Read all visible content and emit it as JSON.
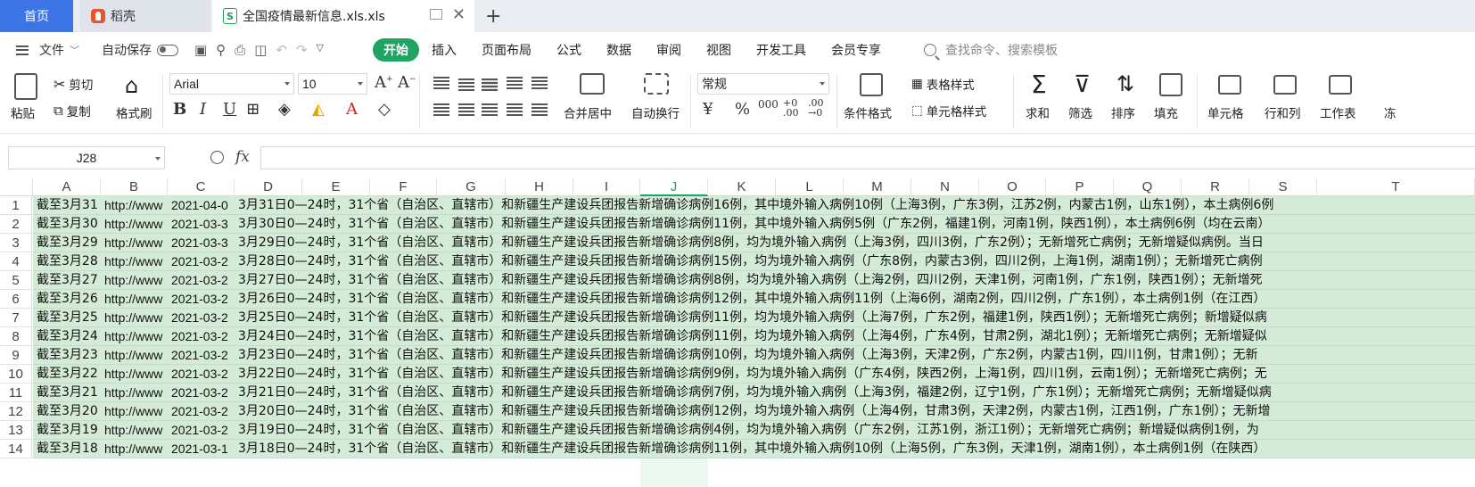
{
  "tabs": {
    "home": "首页",
    "daoke": "稻壳",
    "file": "全国疫情最新信息.xls.xls"
  },
  "menu": {
    "file_label": "文件",
    "autosave_label": "自动保存",
    "ribbon_tabs": [
      "开始",
      "插入",
      "页面布局",
      "公式",
      "数据",
      "审阅",
      "视图",
      "开发工具",
      "会员专享"
    ],
    "search_placeholder": "查找命令、搜索模板"
  },
  "ribbon": {
    "paste": "粘贴",
    "cut": "剪切",
    "copy": "复制",
    "format_painter": "格式刷",
    "font_name": "Arial",
    "font_size": "10",
    "merge_center": "合并居中",
    "wrap_text": "自动换行",
    "number_format": "常规",
    "conditional_format": "条件格式",
    "table_style": "表格样式",
    "cell_style": "单元格样式",
    "sum": "求和",
    "filter": "筛选",
    "sort": "排序",
    "fill": "填充",
    "cell": "单元格",
    "row_col": "行和列",
    "worksheet": "工作表",
    "freeze": "冻"
  },
  "formula_bar": {
    "cell_ref": "J28",
    "fx": "fx",
    "formula": ""
  },
  "columns": [
    "A",
    "B",
    "C",
    "D",
    "E",
    "F",
    "G",
    "H",
    "I",
    "J",
    "K",
    "L",
    "M",
    "N",
    "O",
    "P",
    "Q",
    "R",
    "S",
    "T"
  ],
  "selected_column": "J",
  "rows": [
    {
      "n": "1",
      "a": "截至3月31",
      "b": "http://www",
      "c": "2021-04-0",
      "d": "3月31日0—24时，31个省（自治区、直辖市）和新疆生产建设兵团报告新增确诊病例16例，其中境外输入病例10例（上海3例，广东3例，江苏2例，内蒙古1例，山东1例），本土病例6例"
    },
    {
      "n": "2",
      "a": "截至3月30",
      "b": "http://www",
      "c": "2021-03-3",
      "d": "3月30日0—24时，31个省（自治区、直辖市）和新疆生产建设兵团报告新增确诊病例11例，其中境外输入病例5例（广东2例，福建1例，河南1例，陕西1例），本土病例6例（均在云南）"
    },
    {
      "n": "3",
      "a": "截至3月29",
      "b": "http://www",
      "c": "2021-03-3",
      "d": "3月29日0—24时，31个省（自治区、直辖市）和新疆生产建设兵团报告新增确诊病例8例，均为境外输入病例（上海3例，四川3例，广东2例）；无新增死亡病例；无新增疑似病例。当日"
    },
    {
      "n": "4",
      "a": "截至3月28",
      "b": "http://www",
      "c": "2021-03-2",
      "d": "3月28日0—24时，31个省（自治区、直辖市）和新疆生产建设兵团报告新增确诊病例15例，均为境外输入病例（广东8例，内蒙古3例，四川2例，上海1例，湖南1例）；无新增死亡病例"
    },
    {
      "n": "5",
      "a": "截至3月27",
      "b": "http://www",
      "c": "2021-03-2",
      "d": "3月27日0—24时，31个省（自治区、直辖市）和新疆生产建设兵团报告新增确诊病例8例，均为境外输入病例（上海2例，四川2例，天津1例，河南1例，广东1例，陕西1例）；无新增死"
    },
    {
      "n": "6",
      "a": "截至3月26",
      "b": "http://www",
      "c": "2021-03-2",
      "d": "3月26日0—24时，31个省（自治区、直辖市）和新疆生产建设兵团报告新增确诊病例12例，其中境外输入病例11例（上海6例，湖南2例，四川2例，广东1例），本土病例1例（在江西）"
    },
    {
      "n": "7",
      "a": "截至3月25",
      "b": "http://www",
      "c": "2021-03-2",
      "d": "3月25日0—24时，31个省（自治区、直辖市）和新疆生产建设兵团报告新增确诊病例11例，均为境外输入病例（上海7例，广东2例，福建1例，陕西1例）；无新增死亡病例；新增疑似病"
    },
    {
      "n": "8",
      "a": "截至3月24",
      "b": "http://www",
      "c": "2021-03-2",
      "d": "3月24日0—24时，31个省（自治区、直辖市）和新疆生产建设兵团报告新增确诊病例11例，均为境外输入病例（上海4例，广东4例，甘肃2例，湖北1例）；无新增死亡病例；无新增疑似"
    },
    {
      "n": "9",
      "a": "截至3月23",
      "b": "http://www",
      "c": "2021-03-2",
      "d": "3月23日0—24时，31个省（自治区、直辖市）和新疆生产建设兵团报告新增确诊病例10例，均为境外输入病例（上海3例，天津2例，广东2例，内蒙古1例，四川1例，甘肃1例）；无新"
    },
    {
      "n": "10",
      "a": "截至3月22",
      "b": "http://www",
      "c": "2021-03-2",
      "d": "3月22日0—24时，31个省（自治区、直辖市）和新疆生产建设兵团报告新增确诊病例9例，均为境外输入病例（广东4例，陕西2例，上海1例，四川1例，云南1例）；无新增死亡病例；无"
    },
    {
      "n": "11",
      "a": "截至3月21",
      "b": "http://www",
      "c": "2021-03-2",
      "d": "3月21日0—24时，31个省（自治区、直辖市）和新疆生产建设兵团报告新增确诊病例7例，均为境外输入病例（上海3例，福建2例，辽宁1例，广东1例）；无新增死亡病例；无新增疑似病"
    },
    {
      "n": "12",
      "a": "截至3月20",
      "b": "http://www",
      "c": "2021-03-2",
      "d": "3月20日0—24时，31个省（自治区、直辖市）和新疆生产建设兵团报告新增确诊病例12例，均为境外输入病例（上海4例，甘肃3例，天津2例，内蒙古1例，江西1例，广东1例）；无新增"
    },
    {
      "n": "13",
      "a": "截至3月19",
      "b": "http://www",
      "c": "2021-03-2",
      "d": "3月19日0—24时，31个省（自治区、直辖市）和新疆生产建设兵团报告新增确诊病例4例，均为境外输入病例（广东2例，江苏1例，浙江1例）；无新增死亡病例；新增疑似病例1例，为"
    },
    {
      "n": "14",
      "a": "截至3月18",
      "b": "http://www",
      "c": "2021-03-1",
      "d": "3月18日0—24时，31个省（自治区、直辖市）和新疆生产建设兵团报告新增确诊病例11例，其中境外输入病例10例（上海5例，广东3例，天津1例，湖南1例），本土病例1例（在陕西）"
    }
  ]
}
